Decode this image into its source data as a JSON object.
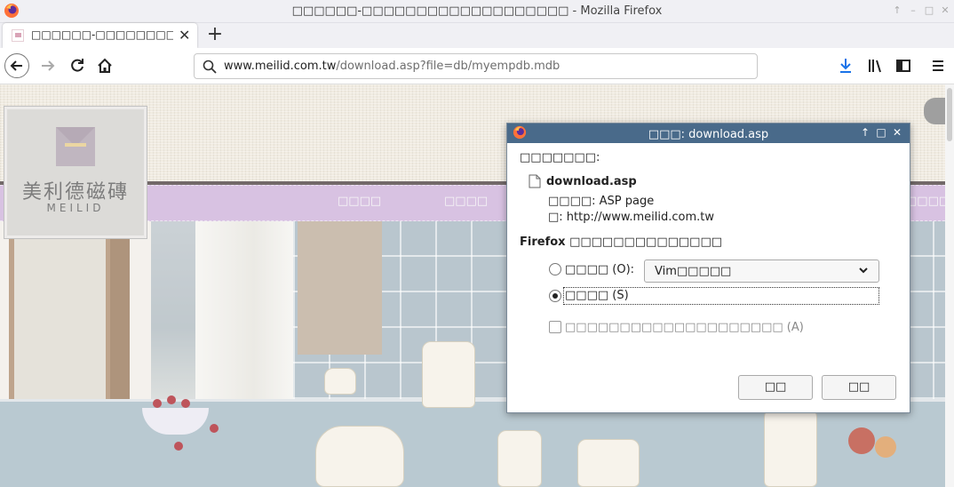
{
  "window": {
    "title_prefix": "□□□□□□-□□□□□□□□□□□□□□□□□□□",
    "title_suffix": " - Mozilla Firefox"
  },
  "tab": {
    "title": "□□□□□□-□□□□□□□□□□□□□□",
    "close": "✕",
    "new_tab": "+"
  },
  "urlbar": {
    "host": "www.meilid.com.tw",
    "path": "/download.asp?file=db/myempdb.mdb"
  },
  "page": {
    "menu": [
      "□□□□",
      "□□□□",
      "□□□□"
    ],
    "logo": {
      "cn": "美利德磁磚",
      "en": "MEILID"
    }
  },
  "dialog": {
    "title": "□□□: download.asp",
    "intro": "□□□□□□□:",
    "filename": "download.asp",
    "type_line": "□□□□: ASP page",
    "from_line": "□: http://www.meilid.com.tw",
    "question": "Firefox □□□□□□□□□□□□□□",
    "open_with_label": "□□□□ (O):",
    "open_with_app": "Vim□□□□□",
    "save_label": "□□□□ (S)",
    "remember_label": "□□□□□□□□□□□□□□□□□□□□ (A)",
    "ok_label": "□□",
    "cancel_label": "□□"
  },
  "colors": {
    "dialog_title_bg": "#496a8a",
    "menu_bar": "#c9abd7",
    "download_icon": "#1a73e8"
  },
  "icons": [
    "firefox-icon",
    "back-icon",
    "forward-icon",
    "reload-icon",
    "home-icon",
    "search-icon",
    "download-icon",
    "library-icon",
    "sidebar-icon",
    "menu-icon",
    "file-icon",
    "chevron-down-icon"
  ]
}
